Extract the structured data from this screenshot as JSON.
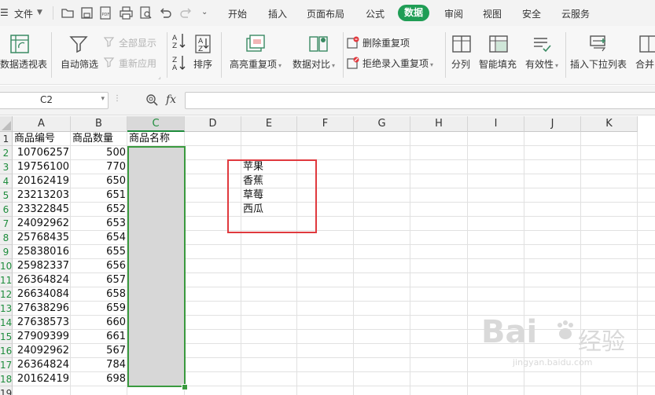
{
  "menubar": {
    "file_label": "文件",
    "tabs": [
      {
        "label": "开始",
        "active": false
      },
      {
        "label": "插入",
        "active": false
      },
      {
        "label": "页面布局",
        "active": false
      },
      {
        "label": "公式",
        "active": false
      },
      {
        "label": "数据",
        "active": true
      },
      {
        "label": "审阅",
        "active": false
      },
      {
        "label": "视图",
        "active": false
      },
      {
        "label": "安全",
        "active": false
      },
      {
        "label": "云服务",
        "active": false
      }
    ],
    "active_color": "#1f9d55"
  },
  "ribbon": {
    "pivot": "数据透视表",
    "autofilter": "自动筛选",
    "show_all": "全部显示",
    "reapply": "重新应用",
    "sort": "排序",
    "highlight_dup": "高亮重复项",
    "data_compare": "数据对比",
    "remove_dup": "删除重复项",
    "reject_dup": "拒绝录入重复项",
    "split": "分列",
    "smart_fill": "智能填充",
    "validity": "有效性",
    "insert_dropdown": "插入下拉列表",
    "merge": "合并"
  },
  "formula_bar": {
    "name_box": "C2",
    "fx_label": "fx",
    "value": ""
  },
  "sheet": {
    "columns": [
      "A",
      "B",
      "C",
      "D",
      "E",
      "F",
      "G",
      "H",
      "I",
      "J",
      "K"
    ],
    "selected_column": "C",
    "row_numbers": [
      "1",
      "2",
      "3",
      "4",
      "5",
      "6",
      "7",
      "8",
      "9",
      "10",
      "11",
      "12",
      "13",
      "14",
      "15",
      "16",
      "17",
      "18",
      "19"
    ],
    "header_row": [
      "商品编号",
      "商品数量",
      "商品名称"
    ],
    "rows": [
      [
        "10706257",
        "500"
      ],
      [
        "19756100",
        "770"
      ],
      [
        "20162419",
        "650"
      ],
      [
        "23213203",
        "651"
      ],
      [
        "23322845",
        "652"
      ],
      [
        "24092962",
        "653"
      ],
      [
        "25768435",
        "654"
      ],
      [
        "25838016",
        "655"
      ],
      [
        "25982337",
        "656"
      ],
      [
        "26364824",
        "657"
      ],
      [
        "26634084",
        "658"
      ],
      [
        "27638296",
        "659"
      ],
      [
        "27638573",
        "660"
      ],
      [
        "27909399",
        "661"
      ],
      [
        "24092962",
        "567"
      ],
      [
        "26364824",
        "784"
      ],
      [
        "20162419",
        "698"
      ]
    ],
    "list_items": [
      "苹果",
      "香蕉",
      "草莓",
      "西瓜"
    ],
    "selection_color": "#3a9a3f",
    "highlight_box_color": "#e0393e"
  },
  "watermark": {
    "brand": "Bai",
    "brand_cn": "经验",
    "url": "jingyan.baidu.com"
  }
}
